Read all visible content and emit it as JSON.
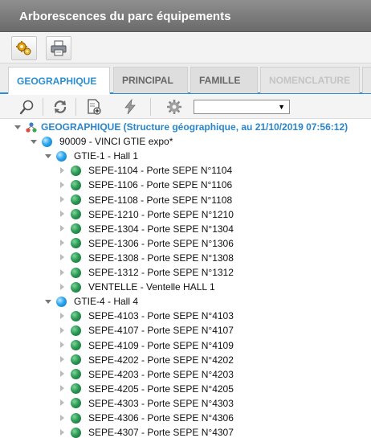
{
  "window": {
    "title": "Arborescences du parc équipements"
  },
  "toolbar": {
    "buttons": [
      {
        "icon": "gears-icon"
      },
      {
        "icon": "printer-icon"
      }
    ]
  },
  "tabs": [
    {
      "label": "GEOGRAPHIQUE",
      "state": "active"
    },
    {
      "label": "PRINCIPAL",
      "state": "normal"
    },
    {
      "label": "FAMILLE",
      "state": "normal"
    },
    {
      "label": "NOMENCLATURE",
      "state": "disabled"
    }
  ],
  "tree_toolbar": {
    "icons": [
      "search-icon",
      "refresh-icon",
      "new-document-icon",
      "lightning-icon",
      "settings-gear-icon"
    ],
    "select_value": ""
  },
  "tree": {
    "root": "GEOGRAPHIQUE (Structure géographique, au 21/10/2019 07:56:12)",
    "site": "90009 - VINCI GTIE expo*",
    "groups": [
      {
        "label": "GTIE-1 - Hall 1",
        "items": [
          "SEPE-1104 - Porte SEPE N°1104",
          "SEPE-1106 - Porte SEPE N°1106",
          "SEPE-1108 - Porte SEPE N°1108",
          "SEPE-1210 - Porte SEPE N°1210",
          "SEPE-1304 - Porte SEPE N°1304",
          "SEPE-1306 - Porte SEPE N°1306",
          "SEPE-1308 - Porte SEPE N°1308",
          "SEPE-1312 - Porte SEPE N°1312",
          "VENTELLE - Ventelle HALL 1"
        ]
      },
      {
        "label": "GTIE-4 - Hall 4",
        "items": [
          "SEPE-4103 - Porte SEPE N°4103",
          "SEPE-4107 - Porte SEPE N°4107",
          "SEPE-4109 - Porte SEPE N°4109",
          "SEPE-4202 - Porte SEPE N°4202",
          "SEPE-4203 - Porte SEPE N°4203",
          "SEPE-4205 - Porte SEPE N°4205",
          "SEPE-4303 - Porte SEPE N°4303",
          "SEPE-4306 - Porte SEPE N°4306",
          "SEPE-4307 - Porte SEPE N°4307"
        ]
      }
    ]
  },
  "colors": {
    "accent": "#2a8fd4",
    "titlebar": "#7a7a7a",
    "node_green": "#2d9a56",
    "node_blue": "#2aa6ee"
  }
}
